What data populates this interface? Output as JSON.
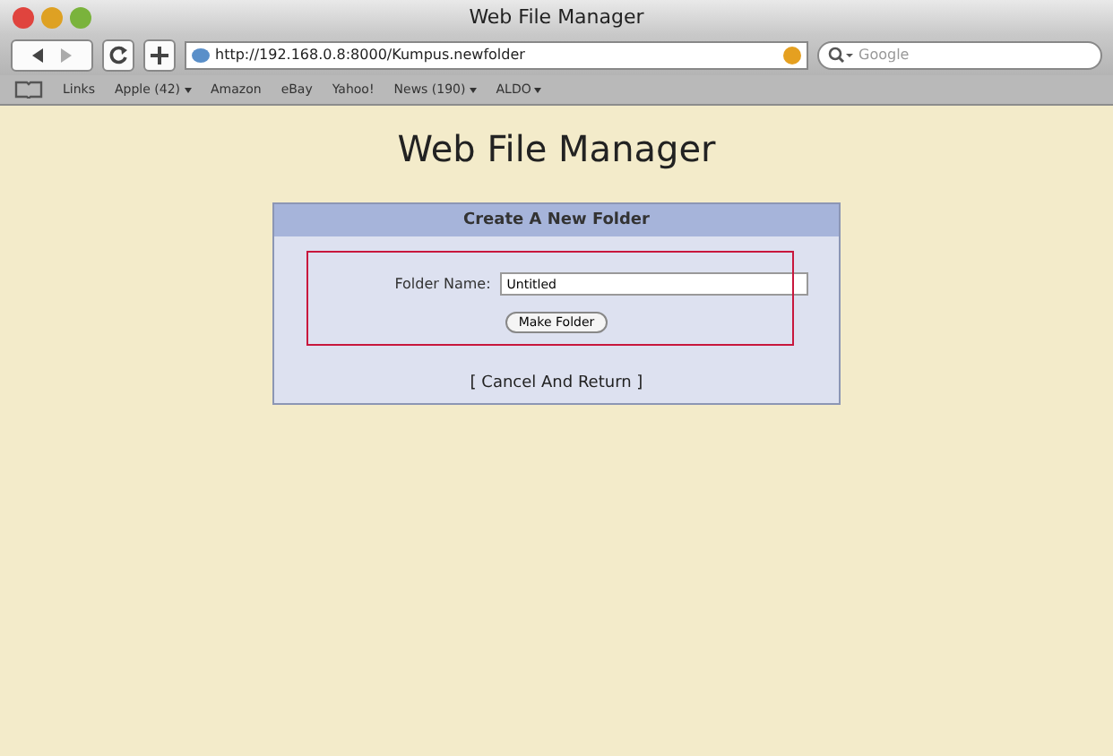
{
  "window": {
    "title": "Web File Manager"
  },
  "toolbar": {
    "url": "http://192.168.0.8:8000/Kumpus.newfolder",
    "search": {
      "placeholder": "Google"
    }
  },
  "bookmarks": [
    {
      "label": "Links",
      "menu": false
    },
    {
      "label": "Apple (42)",
      "menu": true
    },
    {
      "label": "Amazon",
      "menu": false
    },
    {
      "label": "eBay",
      "menu": false
    },
    {
      "label": "Yahoo!",
      "menu": false
    },
    {
      "label": "News (190)",
      "menu": true
    },
    {
      "label": "ALDO",
      "menu": true
    }
  ],
  "page": {
    "heading": "Web File Manager",
    "panel": {
      "title": "Create A New Folder",
      "field_label": "Folder Name:",
      "field_value": "Untitled",
      "button": "Make Folder",
      "link": "[ Cancel And Return ]"
    }
  }
}
